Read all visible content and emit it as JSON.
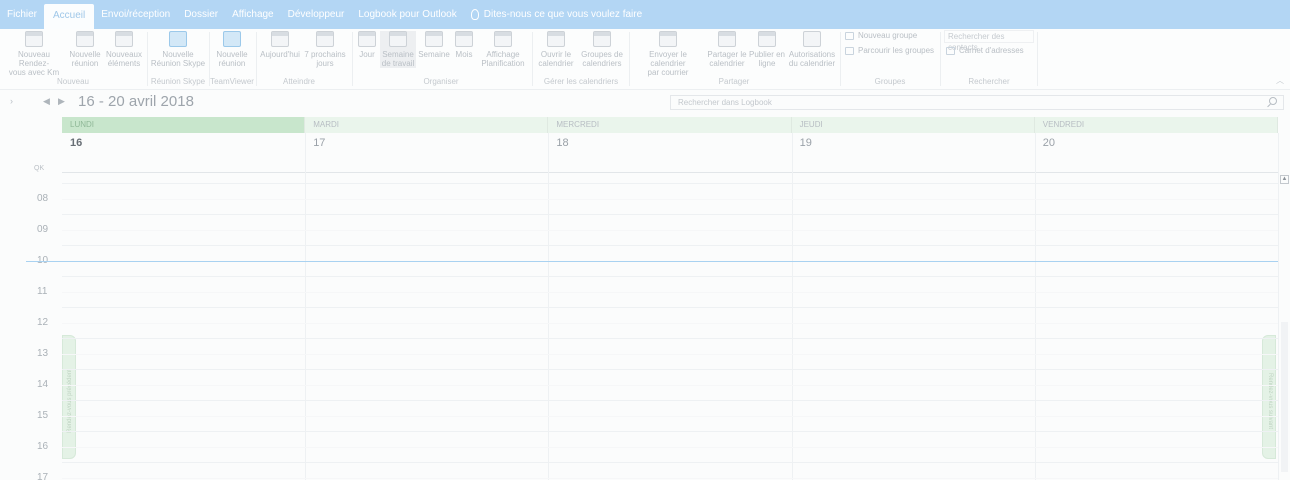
{
  "menu": {
    "tabs": [
      "Fichier",
      "Accueil",
      "Envoi/réception",
      "Dossier",
      "Affichage",
      "Développeur",
      "Logbook pour Outlook"
    ],
    "active_tab": "Accueil",
    "tell_me": "Dites-nous ce que vous voulez faire"
  },
  "ribbon": {
    "nouveau": {
      "rdv_line1": "Nouveau Rendez-",
      "rdv_line2": "vous avec Km",
      "reunion_line1": "Nouvelle",
      "reunion_line2": "réunion",
      "elements_line1": "Nouveaux",
      "elements_line2": "éléments",
      "label": "Nouveau"
    },
    "skype": {
      "line1": "Nouvelle",
      "line2": "Réunion Skype",
      "label": "Réunion Skype"
    },
    "teamviewer": {
      "line1": "Nouvelle",
      "line2": "réunion",
      "label": "TeamViewer"
    },
    "atteindre": {
      "today": "Aujourd'hui",
      "next7_line1": "7 prochains",
      "next7_line2": "jours",
      "label": "Atteindre"
    },
    "organiser": {
      "jour": "Jour",
      "semaine_travail_line1": "Semaine",
      "semaine_travail_line2": "de travail",
      "semaine": "Semaine",
      "mois": "Mois",
      "planif_line1": "Affichage",
      "planif_line2": "Planification",
      "label": "Organiser"
    },
    "gerer": {
      "ouvrir_line1": "Ouvrir le",
      "ouvrir_line2": "calendrier",
      "groupes_line1": "Groupes de",
      "groupes_line2": "calendriers",
      "label": "Gérer les calendriers"
    },
    "partager": {
      "envoyer_line1": "Envoyer le calendrier",
      "envoyer_line2": "par courrier",
      "partager_line1": "Partager le",
      "partager_line2": "calendrier",
      "publier_line1": "Publier en",
      "publier_line2": "ligne",
      "autorisations_line1": "Autorisations",
      "autorisations_line2": "du calendrier",
      "label": "Partager"
    },
    "groupes": {
      "nouveau": "Nouveau groupe",
      "parcourir": "Parcourir les groupes",
      "label": "Groupes"
    },
    "rechercher": {
      "placeholder": "Rechercher des contacts",
      "carnet": "Carnet d'adresses",
      "label": "Rechercher"
    }
  },
  "nav": {
    "range_title": "16 - 20 avril 2018",
    "search_placeholder": "Rechercher dans Logbook"
  },
  "calendar": {
    "days": [
      {
        "name": "LUNDI",
        "num": "16"
      },
      {
        "name": "MARDI",
        "num": "17"
      },
      {
        "name": "MERCREDI",
        "num": "18"
      },
      {
        "name": "JEUDI",
        "num": "19"
      },
      {
        "name": "VENDREDI",
        "num": "20"
      }
    ],
    "today_index": 0,
    "tz_label": "QK",
    "hours": [
      "08",
      "09",
      "10",
      "11",
      "12",
      "13",
      "14",
      "15",
      "16",
      "17"
    ],
    "current_hour": "10",
    "peek_prev": "Rendez-vous précédent",
    "peek_next": "Rendez-vous suivant"
  },
  "colors": {
    "menubar": "#b3d6f4",
    "today_header": "#c8e6cc",
    "day_header": "#eaf5ec",
    "now_line": "#a9d2f1"
  }
}
